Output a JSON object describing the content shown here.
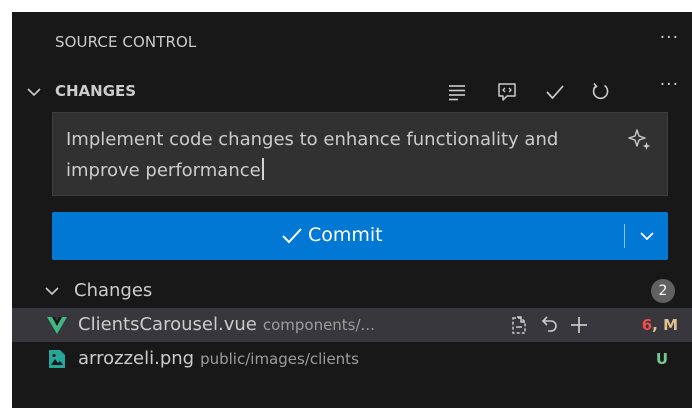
{
  "panel": {
    "title": "SOURCE CONTROL",
    "more_icon": "ellipsis-icon",
    "more_label": "···"
  },
  "changes_section": {
    "title": "CHANGES",
    "actions": [
      "view-as-tree-icon",
      "commit-preview-icon",
      "checkmark-icon",
      "refresh-icon",
      "ellipsis-icon"
    ],
    "more_label": "···"
  },
  "commit_message": {
    "value": "Implement code changes to enhance functionality and improve performance",
    "sparkle_icon": "sparkle-icon"
  },
  "commit_button": {
    "label": "Commit",
    "icon": "checkmark-icon",
    "dropdown_icon": "chevron-down-icon",
    "color": "#0078d4"
  },
  "changes_group": {
    "label": "Changes",
    "count": "2"
  },
  "files": [
    {
      "name": "ClientsCarousel.vue",
      "path": "components/...",
      "icon": "vue-icon",
      "status_count": "6",
      "status_letter": "M",
      "status_color": "#e2c08d",
      "actions": [
        "open-file-icon",
        "discard-changes-icon",
        "stage-plus-icon"
      ]
    },
    {
      "name": "arrozzeli.png",
      "path": "public/images/clients",
      "icon": "image-file-icon",
      "status_letter": "U",
      "status_color": "#73c991"
    }
  ]
}
